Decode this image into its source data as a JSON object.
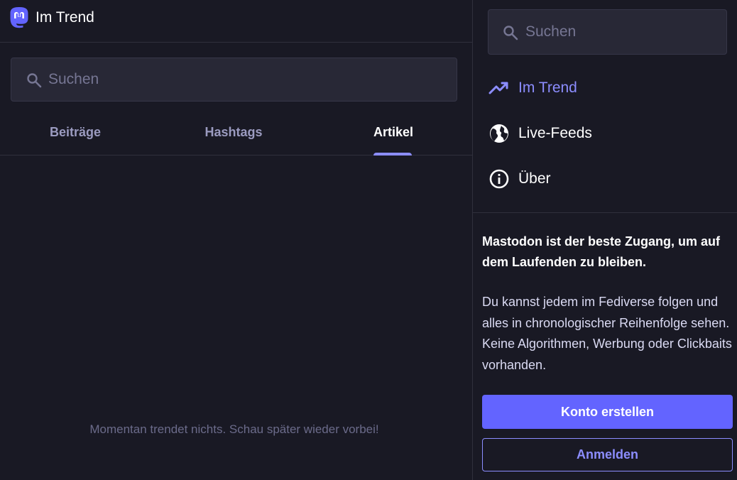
{
  "column": {
    "title": "Im Trend",
    "logo_icon": "mastodon-logo"
  },
  "search": {
    "placeholder": "Suchen"
  },
  "tabs": [
    {
      "label": "Beiträge",
      "active": false
    },
    {
      "label": "Hashtags",
      "active": false
    },
    {
      "label": "Artikel",
      "active": true
    }
  ],
  "empty_message": "Momentan trendet nichts. Schau später wieder vorbei!",
  "navigation": [
    {
      "label": "Im Trend",
      "icon": "trending-icon",
      "active": true
    },
    {
      "label": "Live-Feeds",
      "icon": "globe-icon",
      "active": false
    },
    {
      "label": "Über",
      "icon": "info-icon",
      "active": false
    }
  ],
  "promo": {
    "heading": "Mastodon ist der beste Zugang, um auf dem Laufenden zu bleiben.",
    "text": "Du kannst jedem im Fediverse folgen und alles in chronologischer Reihenfolge sehen. Keine Algorithmen, Werbung oder Clickbaits vorhanden.",
    "primary_button": "Konto erstellen",
    "secondary_button": "Anmelden"
  },
  "colors": {
    "background": "#191924",
    "accent": "#6364ff",
    "accent_light": "#8c8dff",
    "input_bg": "#282836",
    "muted_text": "#9b9bc0"
  }
}
